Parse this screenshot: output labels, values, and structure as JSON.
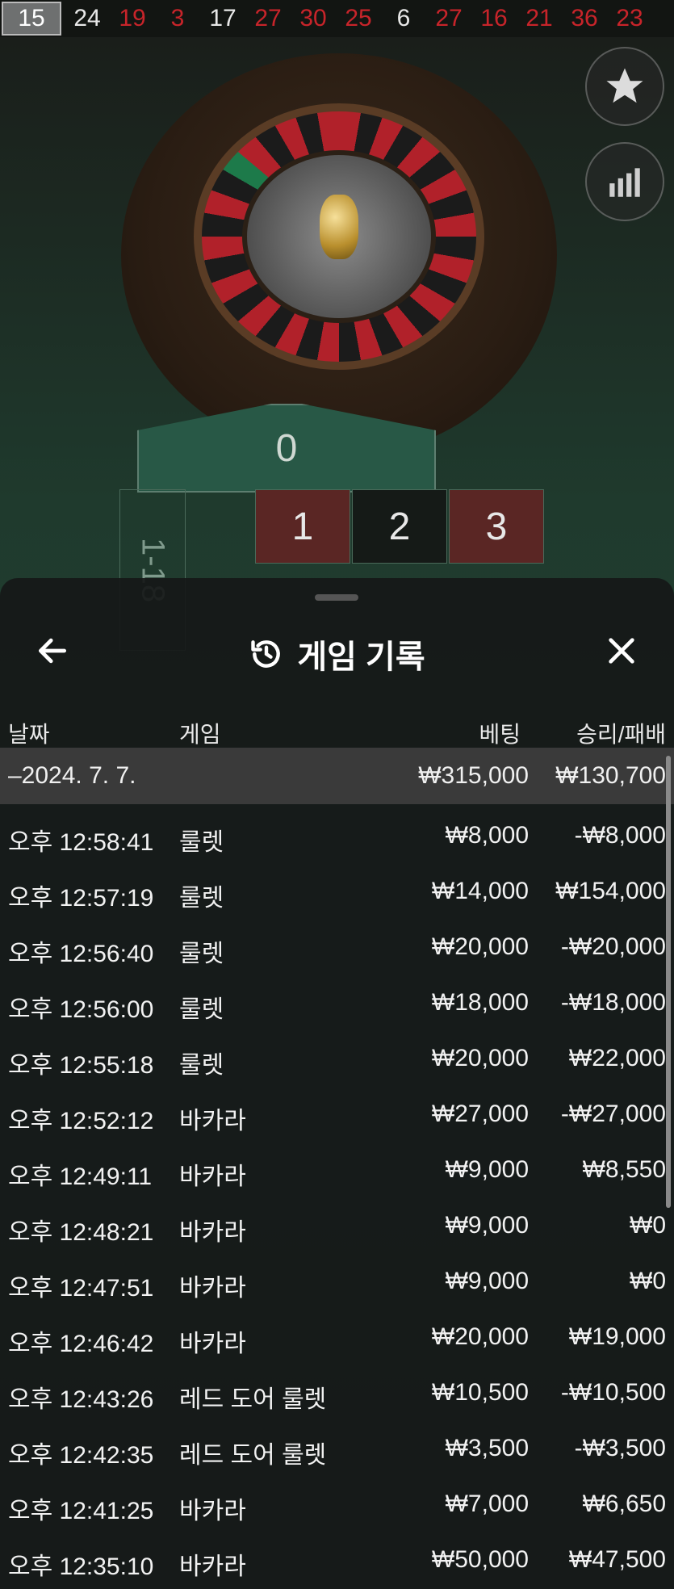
{
  "results_strip": [
    {
      "n": "15",
      "color": "gray"
    },
    {
      "n": "24",
      "color": "black"
    },
    {
      "n": "19",
      "color": "red"
    },
    {
      "n": "3",
      "color": "red"
    },
    {
      "n": "17",
      "color": "black"
    },
    {
      "n": "27",
      "color": "red"
    },
    {
      "n": "30",
      "color": "red"
    },
    {
      "n": "25",
      "color": "red"
    },
    {
      "n": "6",
      "color": "black"
    },
    {
      "n": "27",
      "color": "red"
    },
    {
      "n": "16",
      "color": "red"
    },
    {
      "n": "21",
      "color": "red"
    },
    {
      "n": "36",
      "color": "red"
    },
    {
      "n": "23",
      "color": "red"
    }
  ],
  "table": {
    "zero": "0",
    "n1": "1",
    "n2": "2",
    "n3": "3",
    "range_label": "1-18"
  },
  "sheet": {
    "title": "게임 기록",
    "columns": {
      "date": "날짜",
      "game": "게임",
      "bet": "베팅",
      "result": "승리/패배"
    },
    "summary": {
      "date": "–2024. 7. 7.",
      "bet": "₩315,000",
      "result": "₩130,700"
    },
    "rows": [
      {
        "time": "오후 12:58:41",
        "game": "룰렛",
        "bet": "₩8,000",
        "result": "-₩8,000"
      },
      {
        "time": "오후 12:57:19",
        "game": "룰렛",
        "bet": "₩14,000",
        "result": "₩154,000"
      },
      {
        "time": "오후 12:56:40",
        "game": "룰렛",
        "bet": "₩20,000",
        "result": "-₩20,000"
      },
      {
        "time": "오후 12:56:00",
        "game": "룰렛",
        "bet": "₩18,000",
        "result": "-₩18,000"
      },
      {
        "time": "오후 12:55:18",
        "game": "룰렛",
        "bet": "₩20,000",
        "result": "₩22,000"
      },
      {
        "time": "오후 12:52:12",
        "game": "바카라",
        "bet": "₩27,000",
        "result": "-₩27,000"
      },
      {
        "time": "오후 12:49:11",
        "game": "바카라",
        "bet": "₩9,000",
        "result": "₩8,550"
      },
      {
        "time": "오후 12:48:21",
        "game": "바카라",
        "bet": "₩9,000",
        "result": "₩0"
      },
      {
        "time": "오후 12:47:51",
        "game": "바카라",
        "bet": "₩9,000",
        "result": "₩0"
      },
      {
        "time": "오후 12:46:42",
        "game": "바카라",
        "bet": "₩20,000",
        "result": "₩19,000"
      },
      {
        "time": "오후 12:43:26",
        "game": "레드 도어 룰렛",
        "bet": "₩10,500",
        "result": "-₩10,500"
      },
      {
        "time": "오후 12:42:35",
        "game": "레드 도어 룰렛",
        "bet": "₩3,500",
        "result": "-₩3,500"
      },
      {
        "time": "오후 12:41:25",
        "game": "바카라",
        "bet": "₩7,000",
        "result": "₩6,650"
      },
      {
        "time": "오후 12:35:10",
        "game": "바카라",
        "bet": "₩50,000",
        "result": "₩47,500"
      }
    ]
  },
  "icons": {
    "favorite": "star-icon",
    "stats": "bar-chart-icon",
    "back": "arrow-left-icon",
    "history": "history-icon",
    "close": "close-icon"
  }
}
